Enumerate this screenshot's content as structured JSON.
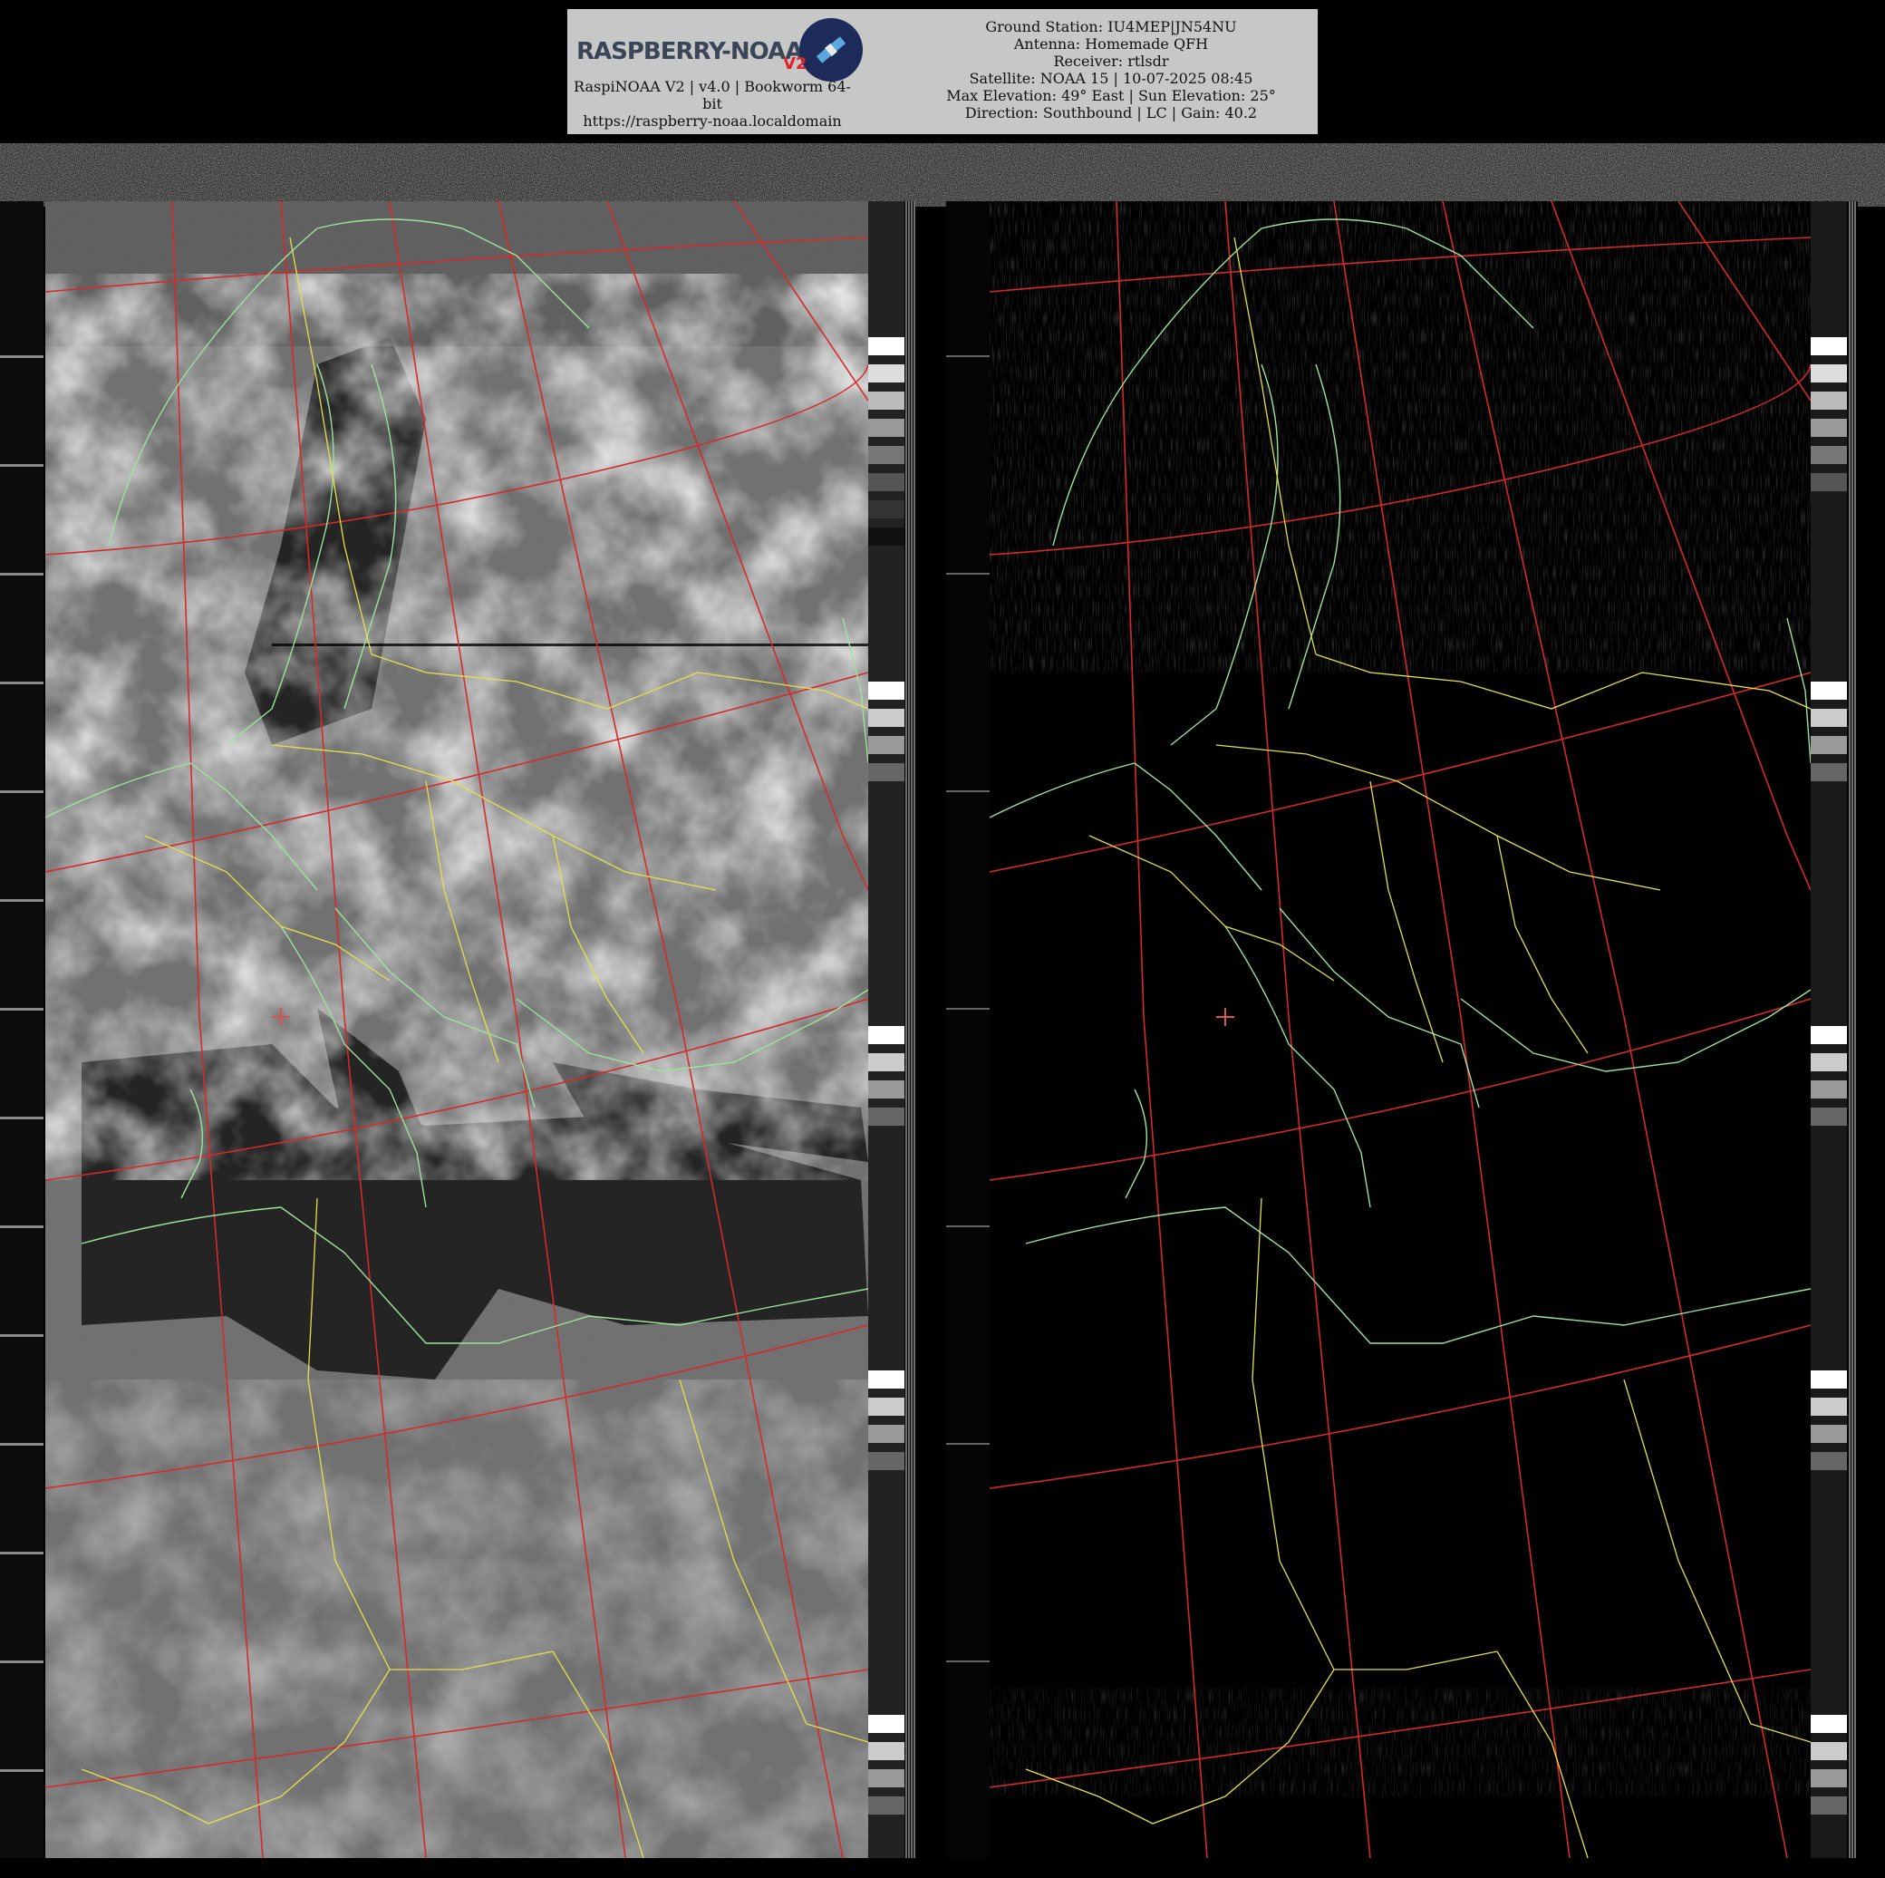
{
  "header": {
    "logo_text": "RASPBERRY-NOAA",
    "logo_version_mark": "V2",
    "left_lines": [
      "RaspiNOAA V2 | v4.0 | Bookworm 64-",
      "bit",
      "https://raspberry-noaa.localdomain"
    ],
    "right_lines": [
      "Ground Station: IU4MEP|JN54NU",
      "Antenna: Homemade QFH",
      "Receiver: rtlsdr",
      "Satellite: NOAA 15 | 10-07-2025 08:45",
      "Max Elevation: 49° East | Sun Elevation: 25°",
      "Direction: Southbound | LC | Gain: 40.2"
    ]
  },
  "image": {
    "panels": [
      "visible-channel",
      "infrared-channel"
    ],
    "colors": {
      "coastline": "#9be49b",
      "border": "#e6e04a",
      "graticule": "#d42a2a",
      "marker": "#e05050"
    },
    "ground_station_marker": "+"
  }
}
